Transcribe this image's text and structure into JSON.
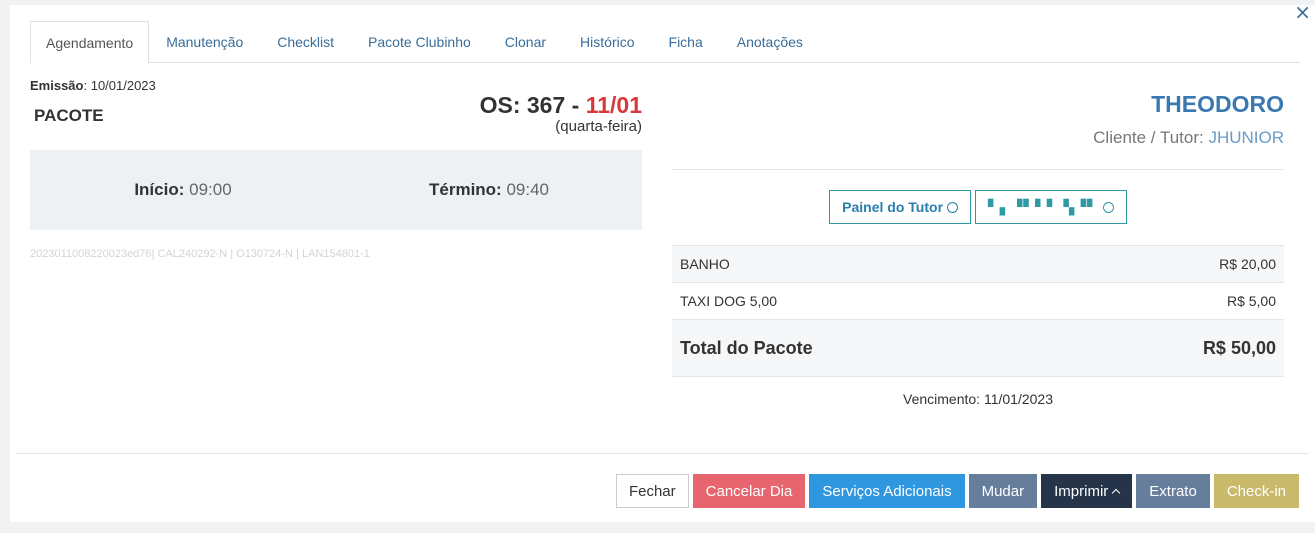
{
  "tabs": [
    "Agendamento",
    "Manutenção",
    "Checklist",
    "Pacote Clubinho",
    "Clonar",
    "Histórico",
    "Ficha",
    "Anotações"
  ],
  "close_icon": "×",
  "emissao": {
    "label": "Emissão",
    "value": ": 10/01/2023"
  },
  "pacote_label": "PACOTE",
  "os": {
    "prefix": "OS: 367 - ",
    "date": "11/01",
    "weekday": "(quarta-feira)"
  },
  "inicio": {
    "label": "Início:",
    "value": " 09:00"
  },
  "termino": {
    "label": "Término:",
    "value": " 09:40"
  },
  "codes": "2023011008220023ed76| CAL240292-N | O130724-N | LAN154801-1",
  "pet_name": "THEODORO",
  "tutor": {
    "label": "Cliente / Tutor: ",
    "name": "JHUNIOR"
  },
  "painel_button": "Painel do Tutor",
  "phone_button": "▘▖▝▘▘▘  ▚▝▘",
  "items": [
    {
      "name": "BANHO",
      "price": "R$ 20,00"
    },
    {
      "name": "TAXI DOG 5,00",
      "price": "R$ 5,00"
    }
  ],
  "total": {
    "label": "Total do Pacote",
    "value": "R$ 50,00"
  },
  "vencimento": "Vencimento: 11/01/2023",
  "footer": {
    "fechar": "Fechar",
    "cancelar": "Cancelar Dia",
    "servicos": "Serviços Adicionais",
    "mudar": "Mudar",
    "imprimir": "Imprimir",
    "extrato": "Extrato",
    "checkin": "Check-in"
  },
  "colors": {
    "accent": "#3a78b0",
    "danger": "#d9383b",
    "checkin": "#c9b96a"
  }
}
